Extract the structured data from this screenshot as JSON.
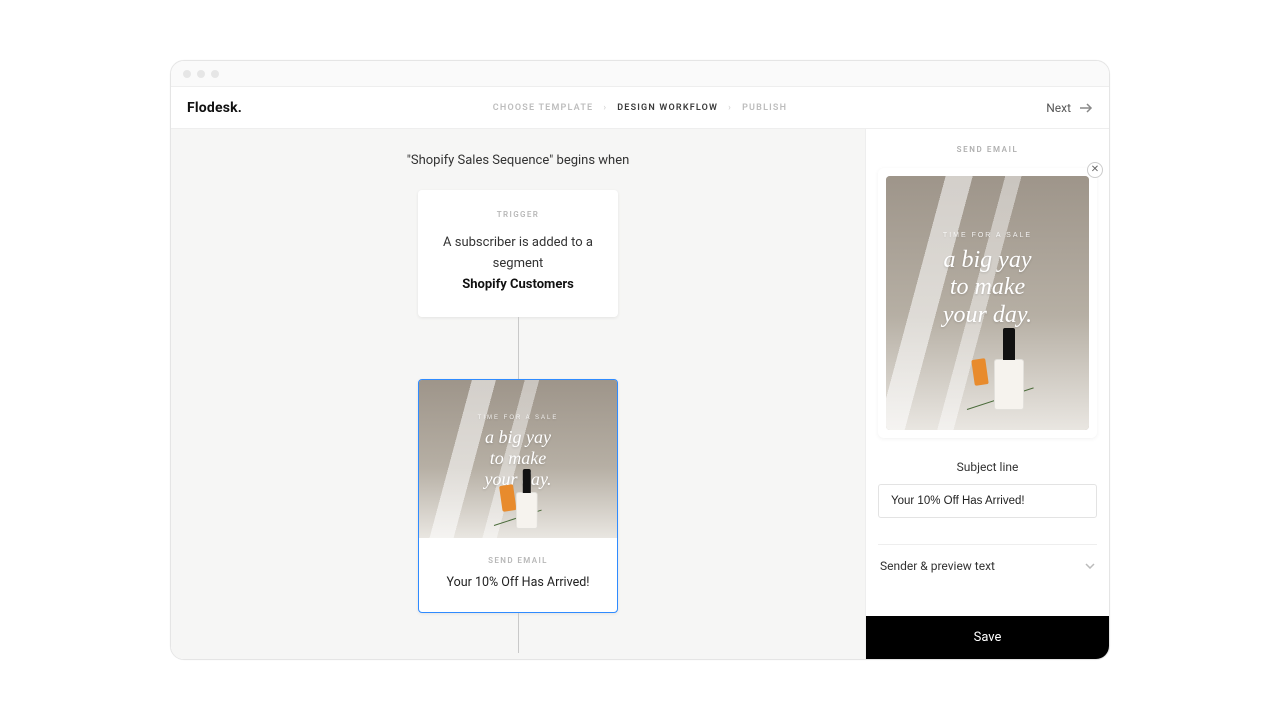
{
  "brand": "Flodesk.",
  "steps": {
    "choose": "Choose Template",
    "design": "Design Workflow",
    "publish": "Publish"
  },
  "next_label": "Next",
  "workflow": {
    "title": "\"Shopify Sales Sequence\" begins when",
    "trigger": {
      "label": "Trigger",
      "line1": "A subscriber is added to a segment",
      "segment": "Shopify Customers"
    },
    "email_step": {
      "label": "Send Email",
      "subject": "Your 10% Off Has Arrived!",
      "art": {
        "kicker": "Time for a sale",
        "headline_l1": "a big yay",
        "headline_l2": "to make",
        "headline_l3": "your day."
      }
    }
  },
  "panel": {
    "label": "Send Email",
    "subject_label": "Subject line",
    "subject_value": "Your 10% Off Has Arrived!",
    "sender_section": "Sender & preview text",
    "save_label": "Save"
  }
}
